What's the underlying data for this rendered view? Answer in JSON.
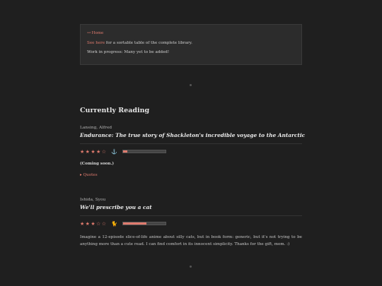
{
  "notice": {
    "home_link": "↤ Home",
    "sortable_link": "See here",
    "sortable_text": " for a sortable table of the complete library.",
    "wip": "Work in progress: Many yet to be added!"
  },
  "section": {
    "title": "Currently Reading"
  },
  "entries": [
    {
      "author": "Lansing, Alfred",
      "title": "Endurance: The true story of Shackleton's incredible voyage to the Antarctic",
      "stars": "★★★★☆",
      "rating": 4,
      "icon": "anchor-icon",
      "icon_glyph": "⚓",
      "progress": 0.1,
      "note": "(Coming soon.)",
      "quotes_label": "▸ Quotes"
    },
    {
      "author": "Ishida, Syou",
      "title": "We'll prescribe you a cat",
      "stars": "★★★☆☆",
      "rating": 3,
      "icon": "cat-icon",
      "icon_glyph": "🐈",
      "progress": 0.55,
      "description": "Imagine a 12-episode slice-of-life anime about silly cats, but in book form: generic, but it's not trying to be anything more than a cute read. I can find comfort in its innocent simplicity. Thanks for the gift, mom. :)"
    }
  ],
  "colors": {
    "accent": "#e07b6e",
    "background": "#1f1f1f",
    "panel": "#2c2c2c"
  }
}
